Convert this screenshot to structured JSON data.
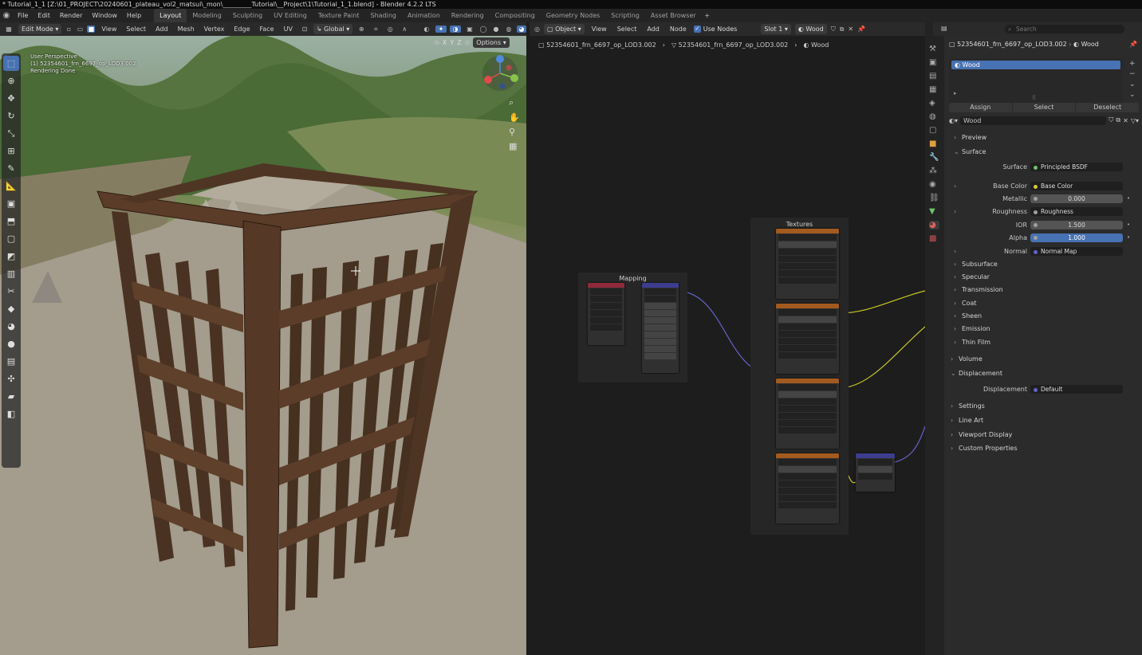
{
  "title_bar": "* Tutorial_1_1 [Z:\\01_PROJECT\\20240601_plateau_vol2_matsui\\_mon\\_________Tutorial\\__Project\\1\\Tutorial_1_1.blend] - Blender 4.2.2 LTS",
  "menus": [
    "File",
    "Edit",
    "Render",
    "Window",
    "Help"
  ],
  "workspaces": [
    "Layout",
    "Modeling",
    "Sculpting",
    "UV Editing",
    "Texture Paint",
    "Shading",
    "Animation",
    "Rendering",
    "Compositing",
    "Geometry Nodes",
    "Scripting",
    "Asset Browser"
  ],
  "active_workspace": "Layout",
  "viewport": {
    "mode": "Edit Mode",
    "menus": [
      "View",
      "Select",
      "Add",
      "Mesh",
      "Vertex",
      "Edge",
      "Face",
      "UV"
    ],
    "orientation": "Global",
    "options": "Options",
    "axes": [
      "X",
      "Y",
      "Z"
    ],
    "info": [
      "User Perspective",
      "(1) 52354601_frn_6697_op_LOD3.002",
      "Rendering Done"
    ]
  },
  "node_editor": {
    "object_mode": "Object",
    "menus": [
      "View",
      "Select",
      "Add",
      "Node"
    ],
    "use_nodes_label": "Use Nodes",
    "slot": "Slot 1",
    "material": "Wood",
    "breadcrumb": [
      "52354601_frn_6697_op_LOD3.002",
      "52354601_frn_6697_op_LOD3.002",
      "Wood"
    ],
    "frames": {
      "mapping": "Mapping",
      "textures": "Textures"
    }
  },
  "properties": {
    "search_placeholder": "Search",
    "object_name": "52354601_frn_6697_op_LOD3.002",
    "material_name": "Wood",
    "slot_item": "Wood",
    "assign": "Assign",
    "select": "Select",
    "deselect": "Deselect",
    "material_field": "Wood",
    "sections": {
      "preview": "Preview",
      "surface": "Surface",
      "subsurface": "Subsurface",
      "specular": "Specular",
      "transmission": "Transmission",
      "coat": "Coat",
      "sheen": "Sheen",
      "emission": "Emission",
      "thin_film": "Thin Film",
      "volume": "Volume",
      "displacement": "Displacement",
      "settings": "Settings",
      "line_art": "Line Art",
      "viewport_display": "Viewport Display",
      "custom_properties": "Custom Properties"
    },
    "fields": {
      "surface_label": "Surface",
      "surface_value": "Principled BSDF",
      "base_color_label": "Base Color",
      "base_color_value": "Base Color",
      "metallic_label": "Metallic",
      "metallic_value": "0.000",
      "roughness_label": "Roughness",
      "roughness_value": "Roughness",
      "ior_label": "IOR",
      "ior_value": "1.500",
      "alpha_label": "Alpha",
      "alpha_value": "1.000",
      "normal_label": "Normal",
      "normal_value": "Normal Map",
      "displacement_label": "Displacement",
      "displacement_value": "Default"
    }
  },
  "colors": {
    "accent_blue": "#4772b3",
    "texture_node_header": "#a35a1e",
    "shader_node_header": "#3d3d8f",
    "input_node_header": "#8f2a3a",
    "link_yellow": "#c7c729",
    "link_purple": "#6363c7",
    "wood": "#4a3222"
  }
}
